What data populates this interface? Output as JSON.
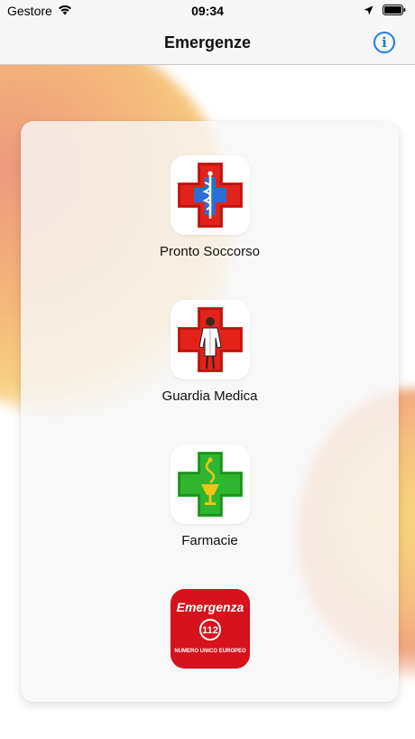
{
  "status_bar": {
    "carrier": "Gestore",
    "time": "09:34"
  },
  "nav": {
    "title": "Emergenze",
    "info_icon_glyph": "i"
  },
  "items": [
    {
      "label": "Pronto Soccorso",
      "icon": "red-cross-caduceus-icon"
    },
    {
      "label": "Guardia Medica",
      "icon": "red-cross-doctor-icon"
    },
    {
      "label": "Farmacie",
      "icon": "green-cross-pharmacy-icon"
    },
    {
      "label": "",
      "icon": "emergency-112-logo"
    }
  ],
  "emergency_logo": {
    "title": "Emergenza",
    "number": "112",
    "subtitle": "NUMERO UNICO EUROPEO"
  },
  "colors": {
    "accent": "#1e7ae8",
    "red_cross": "#e32219",
    "green_cross": "#2fb52f",
    "emergency_red": "#d6121c"
  }
}
